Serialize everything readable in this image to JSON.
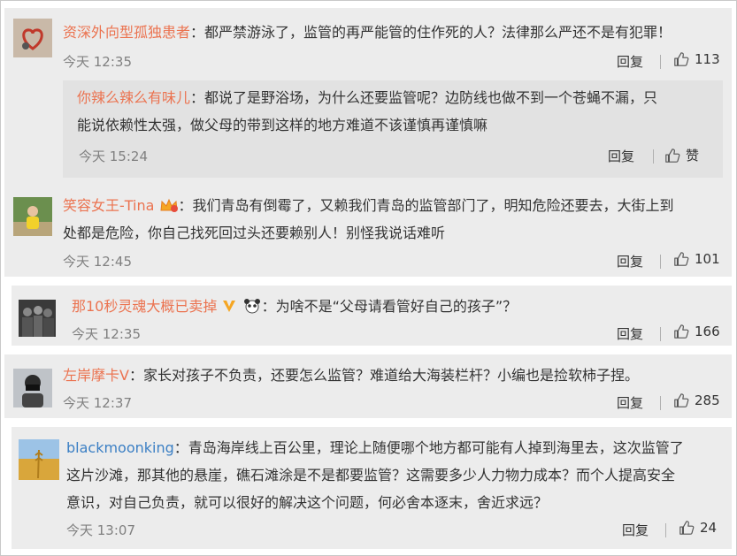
{
  "comments": [
    {
      "username": "资深外向型孤独患者",
      "text": "：都严禁游泳了，监管的再严能管的住作死的人？法律那么严还不是有犯罪！",
      "time": "今天 12:35",
      "reply_label": "回复",
      "likes": "113",
      "avatar_icon": "heart-sketch-avatar",
      "sub_reply": {
        "username": "你辣么辣么有味儿",
        "text_line1": "：都说了是野浴场，为什么还要监管呢？边防线也做不到一个苍蝇不漏，只",
        "text_line2": "能说依赖性太强，做父母的带到这样的地方难道不该谨慎再谨慎嘛",
        "time": "今天 15:24",
        "reply_label": "回复",
        "likes": "赞"
      }
    },
    {
      "username": "笑容女王-Tina",
      "badge_icon": "crown-badge-icon",
      "text_line1": "：我们青岛有倒霉了，又赖我们青岛的监管部门了，明知危险还要去，大街上到",
      "text_line2": "处都是危险，你自己找死回过头还要赖别人！别怪我说话难听",
      "time": "今天 12:45",
      "reply_label": "回复",
      "likes": "101",
      "avatar_icon": "child-photo-avatar"
    },
    {
      "username": "那10秒灵魂大概已卖掉",
      "badge_icon": "vip-v-badge-icon",
      "badge2_icon": "panda-badge-icon",
      "text": "：为啥不是“父母请看管好自己的孩子”？",
      "time": "今天 12:35",
      "reply_label": "回复",
      "likes": "166",
      "avatar_icon": "crowd-photo-avatar"
    },
    {
      "username": "左岸摩卡V",
      "text": "：家长对孩子不负责，还要怎么监管？难道给大海装栏杆？小编也是捡软柿子捏。",
      "time": "今天 12:37",
      "reply_label": "回复",
      "likes": "285",
      "avatar_icon": "masked-man-avatar"
    },
    {
      "username": "blackmoonking",
      "text_line1": "：青岛海岸线上百公里，理论上随便哪个地方都可能有人掉到海里去，这次监管了",
      "text_line2": "这片沙滩，那其他的悬崖，礁石滩涂是不是都要监管？这需要多少人力物力成本？而个人提高安全",
      "text_line3": "意识，对自己负责，就可以很好的解决这个问题，何必舍本逐末，舍近求远？",
      "time": "今天 13:07",
      "reply_label": "回复",
      "likes": "24",
      "avatar_icon": "wheat-field-avatar"
    }
  ],
  "colors": {
    "username": "#eb7350",
    "username_alt": "#3b7fc4",
    "card_bg": "#ececec",
    "time": "#808080"
  }
}
